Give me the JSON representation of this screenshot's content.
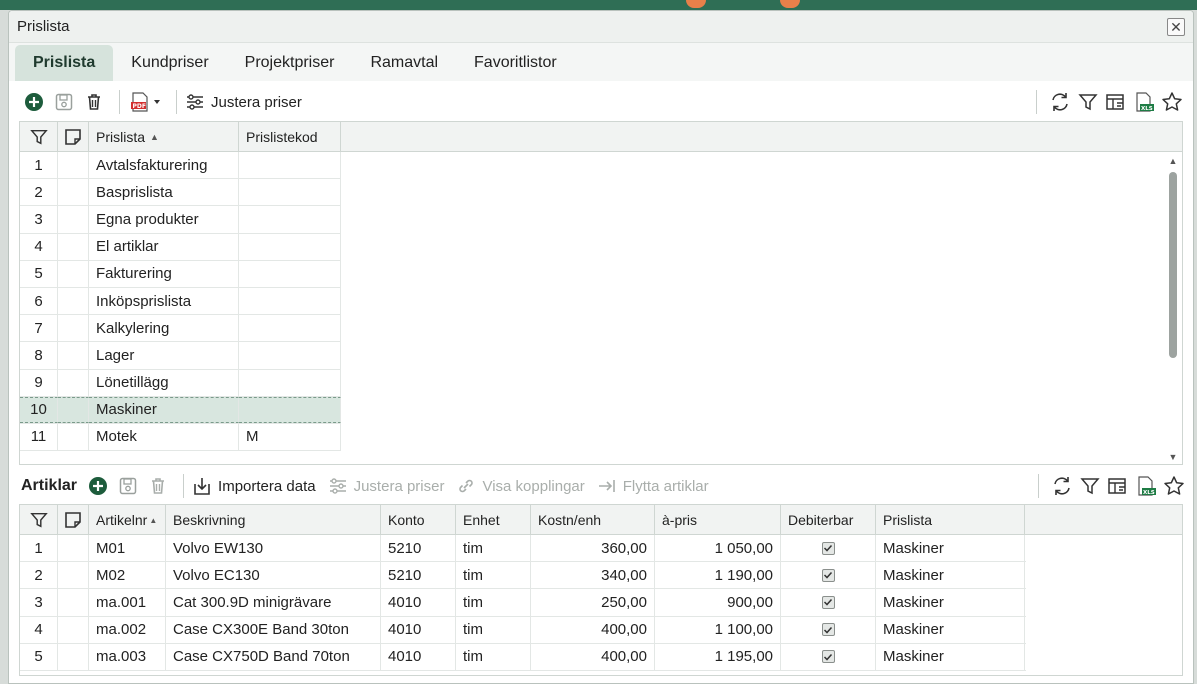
{
  "window": {
    "title": "Prislista"
  },
  "tabs": [
    {
      "label": "Prislista",
      "active": true
    },
    {
      "label": "Kundpriser"
    },
    {
      "label": "Projektpriser"
    },
    {
      "label": "Ramavtal"
    },
    {
      "label": "Favoritlistor"
    }
  ],
  "toolbar_top": {
    "adjust_prices_label": "Justera priser"
  },
  "pricelist_grid": {
    "headers": {
      "name": "Prislista",
      "code": "Prislistekod"
    },
    "rows": [
      {
        "nr": "1",
        "name": "Avtalsfakturering",
        "code": ""
      },
      {
        "nr": "2",
        "name": "Basprislista",
        "code": ""
      },
      {
        "nr": "3",
        "name": "Egna produkter",
        "code": ""
      },
      {
        "nr": "4",
        "name": "El artiklar",
        "code": ""
      },
      {
        "nr": "5",
        "name": "Fakturering",
        "code": ""
      },
      {
        "nr": "6",
        "name": "Inköpsprislista",
        "code": ""
      },
      {
        "nr": "7",
        "name": "Kalkylering",
        "code": ""
      },
      {
        "nr": "8",
        "name": "Lager",
        "code": ""
      },
      {
        "nr": "9",
        "name": "Lönetillägg",
        "code": ""
      },
      {
        "nr": "10",
        "name": "Maskiner",
        "code": "",
        "selected": true
      },
      {
        "nr": "11",
        "name": "Motek",
        "code": "M"
      }
    ]
  },
  "articles_section": {
    "label": "Artiklar",
    "import_label": "Importera data",
    "adjust_prices_label": "Justera priser",
    "show_links_label": "Visa kopplingar",
    "move_articles_label": "Flytta artiklar"
  },
  "articles_grid": {
    "headers": {
      "artnr": "Artikelnr",
      "desc": "Beskrivning",
      "account": "Konto",
      "unit": "Enhet",
      "cost": "Kostn/enh",
      "price": "à-pris",
      "billable": "Debiterbar",
      "pricelist": "Prislista"
    },
    "rows": [
      {
        "nr": "1",
        "artnr": "M01",
        "desc": "Volvo EW130",
        "account": "5210",
        "unit": "tim",
        "cost": "360,00",
        "price": "1 050,00",
        "billable": true,
        "pricelist": "Maskiner"
      },
      {
        "nr": "2",
        "artnr": "M02",
        "desc": "Volvo EC130",
        "account": "5210",
        "unit": "tim",
        "cost": "340,00",
        "price": "1 190,00",
        "billable": true,
        "pricelist": "Maskiner"
      },
      {
        "nr": "3",
        "artnr": "ma.001",
        "desc": "Cat 300.9D minigrävare",
        "account": "4010",
        "unit": "tim",
        "cost": "250,00",
        "price": "900,00",
        "billable": true,
        "pricelist": "Maskiner"
      },
      {
        "nr": "4",
        "artnr": "ma.002",
        "desc": "Case CX300E Band 30ton",
        "account": "4010",
        "unit": "tim",
        "cost": "400,00",
        "price": "1 100,00",
        "billable": true,
        "pricelist": "Maskiner"
      },
      {
        "nr": "5",
        "artnr": "ma.003",
        "desc": "Case CX750D Band 70ton",
        "account": "4010",
        "unit": "tim",
        "cost": "400,00",
        "price": "1 195,00",
        "billable": true,
        "pricelist": "Maskiner"
      }
    ]
  },
  "colors": {
    "accent": "#1d6b45",
    "tab_active_bg": "#d6e3dc",
    "selected_row_bg": "#d8e6df"
  }
}
